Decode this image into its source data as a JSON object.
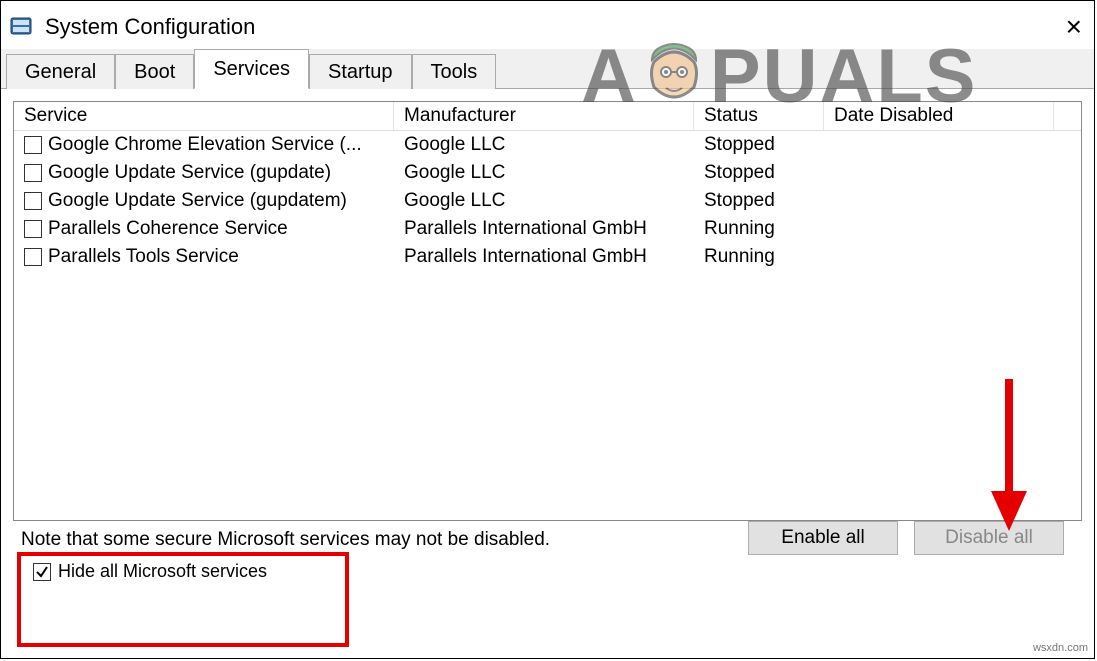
{
  "window": {
    "title": "System Configuration"
  },
  "tabs": {
    "general": "General",
    "boot": "Boot",
    "services": "Services",
    "startup": "Startup",
    "tools": "Tools"
  },
  "columns": {
    "service": "Service",
    "manufacturer": "Manufacturer",
    "status": "Status",
    "date_disabled": "Date Disabled"
  },
  "services": [
    {
      "checked": false,
      "name": "Google Chrome Elevation Service (...",
      "manufacturer": "Google LLC",
      "status": "Stopped",
      "date_disabled": ""
    },
    {
      "checked": false,
      "name": "Google Update Service (gupdate)",
      "manufacturer": "Google LLC",
      "status": "Stopped",
      "date_disabled": ""
    },
    {
      "checked": false,
      "name": "Google Update Service (gupdatem)",
      "manufacturer": "Google LLC",
      "status": "Stopped",
      "date_disabled": ""
    },
    {
      "checked": false,
      "name": "Parallels Coherence Service",
      "manufacturer": "Parallels International GmbH",
      "status": "Running",
      "date_disabled": ""
    },
    {
      "checked": false,
      "name": "Parallels Tools Service",
      "manufacturer": "Parallels International GmbH",
      "status": "Running",
      "date_disabled": ""
    }
  ],
  "note": "Note that some secure Microsoft services may not be disabled.",
  "buttons": {
    "enable_all": "Enable all",
    "disable_all": "Disable all"
  },
  "hide_ms": {
    "checked": true,
    "label": "Hide all Microsoft services"
  },
  "watermark": {
    "part1": "A",
    "part2": "PUALS"
  },
  "credit": "wsxdn.com"
}
